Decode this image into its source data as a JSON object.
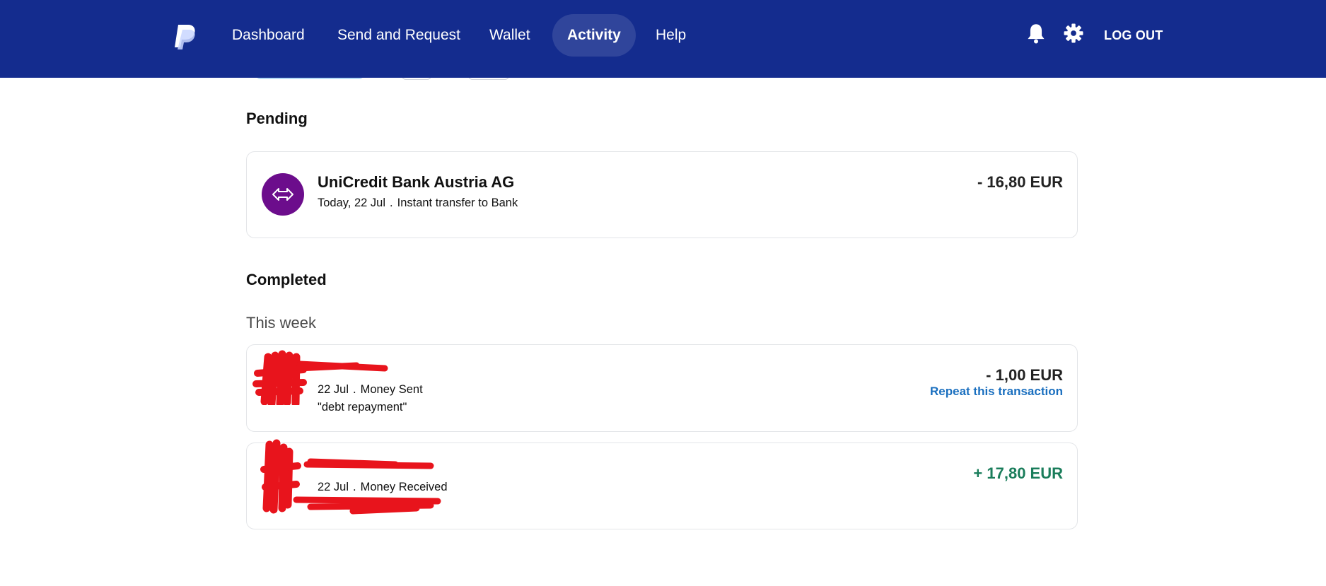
{
  "nav": {
    "items": [
      {
        "label": "Dashboard"
      },
      {
        "label": "Send and Request"
      },
      {
        "label": "Wallet"
      },
      {
        "label": "Activity"
      },
      {
        "label": "Help"
      }
    ],
    "active": "Activity",
    "logout_label": "LOG OUT",
    "icons": [
      "paypal-logo",
      "bell-icon",
      "gear-icon"
    ],
    "background_color": "#142c8e"
  },
  "pending": {
    "title": "Pending",
    "transactions": [
      {
        "name": "UniCredit Bank Austria AG",
        "date": "Today, 22 Jul",
        "separator": ".",
        "type": "Instant transfer to Bank",
        "amount": "- 16,80 EUR",
        "icon": "transfer-icon",
        "icon_color": "#6c0d8c"
      }
    ]
  },
  "completed": {
    "title": "Completed",
    "group_label": "This week",
    "transactions": [
      {
        "date": "22 Jul",
        "separator": ".",
        "type": "Money Sent",
        "note": "\"debt repayment\"",
        "amount": "- 1,00 EUR",
        "action_label": "Repeat this transaction"
      },
      {
        "date": "22 Jul",
        "separator": ".",
        "type": "Money Received",
        "amount": "+ 17,80 EUR",
        "amount_color": "#1a7d5b"
      }
    ]
  },
  "colors": {
    "negative_amount": "#222222",
    "positive_amount": "#1a7d5b",
    "link": "#1a6fbf",
    "redaction": "#e8141c"
  }
}
